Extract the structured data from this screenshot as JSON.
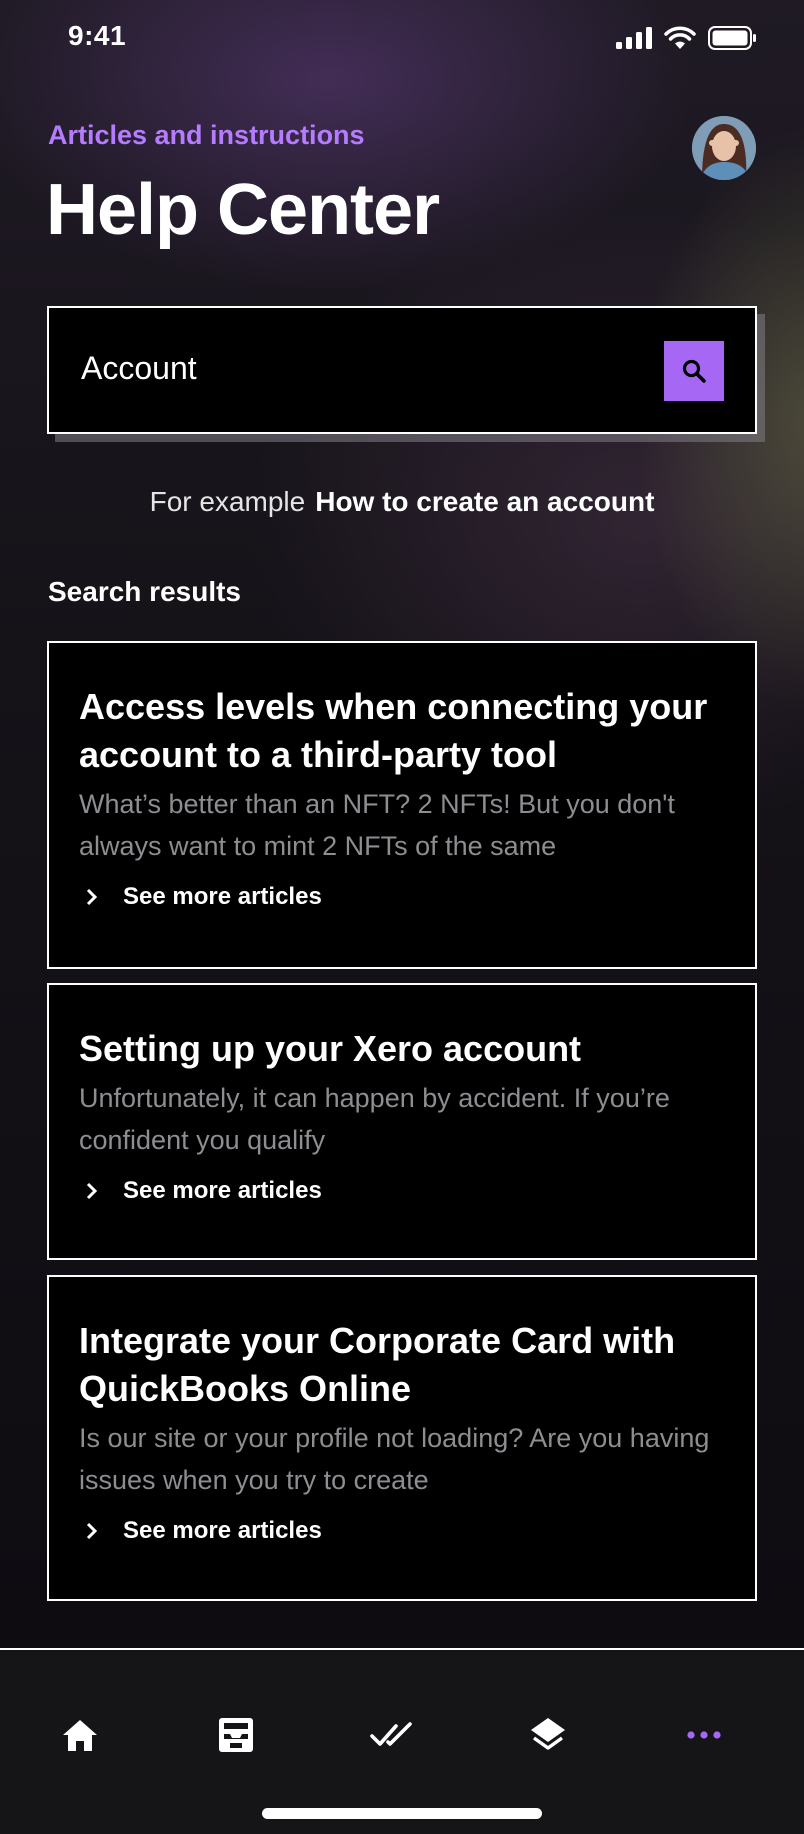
{
  "status_bar": {
    "time": "9:41"
  },
  "header": {
    "subtitle": "Articles and instructions",
    "title": "Help Center"
  },
  "search": {
    "value": "Account"
  },
  "example": {
    "prefix": "For example",
    "link": "How to create an account"
  },
  "results": {
    "heading": "Search results",
    "items": [
      {
        "title": "Access levels when connecting your account to a third-party tool",
        "excerpt": "What’s better than an NFT? 2 NFTs! But you don't always want to mint 2 NFTs of the same",
        "more": "See more articles"
      },
      {
        "title": "Setting up your Xero account",
        "excerpt": "Unfortunately, it can happen by accident. If you’re confident you qualify",
        "more": "See more articles"
      },
      {
        "title": "Integrate your Corporate Card with QuickBooks Online",
        "excerpt": "Is our site or your profile not loading? Are you having issues when you try to create",
        "more": "See more articles"
      }
    ]
  },
  "tabbar": {
    "items": [
      {
        "icon": "home-icon"
      },
      {
        "icon": "inbox-icon"
      },
      {
        "icon": "double-check-icon"
      },
      {
        "icon": "layers-icon"
      },
      {
        "icon": "more-icon",
        "active": true
      }
    ]
  },
  "colors": {
    "accent": "#a667f5",
    "subtitle": "#b57cff",
    "card_bg": "#000000",
    "excerpt": "#8d8d92"
  }
}
